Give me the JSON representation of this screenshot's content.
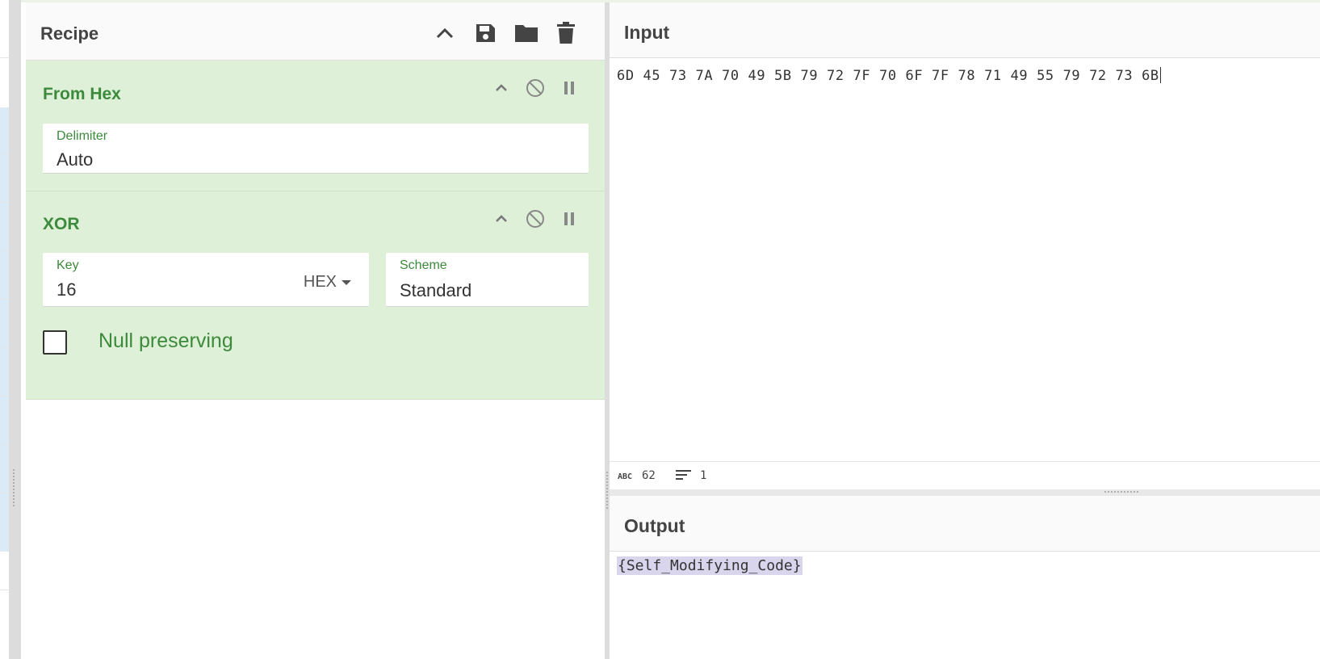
{
  "recipe": {
    "title": "Recipe",
    "icons": [
      "chevron-up-icon",
      "save-icon",
      "folder-icon",
      "trash-icon"
    ],
    "operations": [
      {
        "name": "From Hex",
        "fields": [
          {
            "label": "Delimiter",
            "value": "Auto"
          }
        ]
      },
      {
        "name": "XOR",
        "fields": [
          {
            "label": "Key",
            "value": "16",
            "format": "HEX"
          },
          {
            "label": "Scheme",
            "value": "Standard"
          }
        ],
        "checkbox": {
          "label": "Null preserving",
          "checked": false
        }
      }
    ]
  },
  "input": {
    "title": "Input",
    "text": "6D 45 73 7A 70 49 5B 79 72 7F 70 6F 7F 78 71 49 55 79 72 73 6B",
    "status": {
      "chars": "62",
      "lines": "1"
    }
  },
  "output": {
    "title": "Output",
    "text": "{Self_Modifying_Code}"
  },
  "colors": {
    "operation_bg": "#dff0d8",
    "operation_text": "#3c8a3c",
    "selection_bg": "#d9d5ec"
  }
}
